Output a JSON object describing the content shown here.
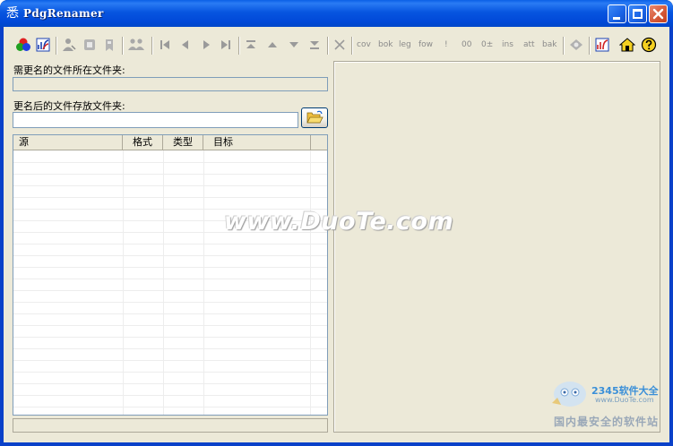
{
  "window": {
    "title": "PdgRenamer",
    "app_icon_glyph": "悉"
  },
  "toolbar": {
    "buttons": [
      {
        "name": "colors-icon"
      },
      {
        "name": "rename-icon"
      },
      {
        "name": "user-icon"
      },
      {
        "name": "page-icon"
      },
      {
        "name": "tag-icon"
      },
      {
        "name": "people-icon"
      },
      {
        "name": "first-icon"
      },
      {
        "name": "prev-icon"
      },
      {
        "name": "next-icon"
      },
      {
        "name": "last-icon"
      },
      {
        "name": "move-top-icon"
      },
      {
        "name": "move-up-icon"
      },
      {
        "name": "move-down-icon"
      },
      {
        "name": "move-bottom-icon"
      },
      {
        "name": "delete-icon"
      }
    ],
    "text_buttons": [
      "cov",
      "bok",
      "leg",
      "fow",
      "!",
      "00",
      "0±",
      "ins",
      "att",
      "bak"
    ],
    "right_buttons": [
      {
        "name": "settings-icon"
      },
      {
        "name": "web-icon"
      },
      {
        "name": "home-icon"
      },
      {
        "name": "help-icon"
      }
    ]
  },
  "form": {
    "source_folder_label": "需更名的文件所在文件夹:",
    "source_folder_value": "",
    "target_folder_label": "更名后的文件存放文件夹:",
    "target_folder_value": ""
  },
  "table": {
    "columns": [
      "源",
      "格式",
      "类型",
      "目标"
    ],
    "rows": []
  },
  "watermark": {
    "main": "www.DuoTe.com",
    "logo_line1": "2345软件大全",
    "logo_line2": "www.DuoTe.com",
    "logo_line3": "国内最安全的软件站"
  },
  "colors": {
    "title_bar": "#0054e3",
    "face": "#ece9d8",
    "field_border": "#7f9db9",
    "close_button": "#d65a3a"
  }
}
